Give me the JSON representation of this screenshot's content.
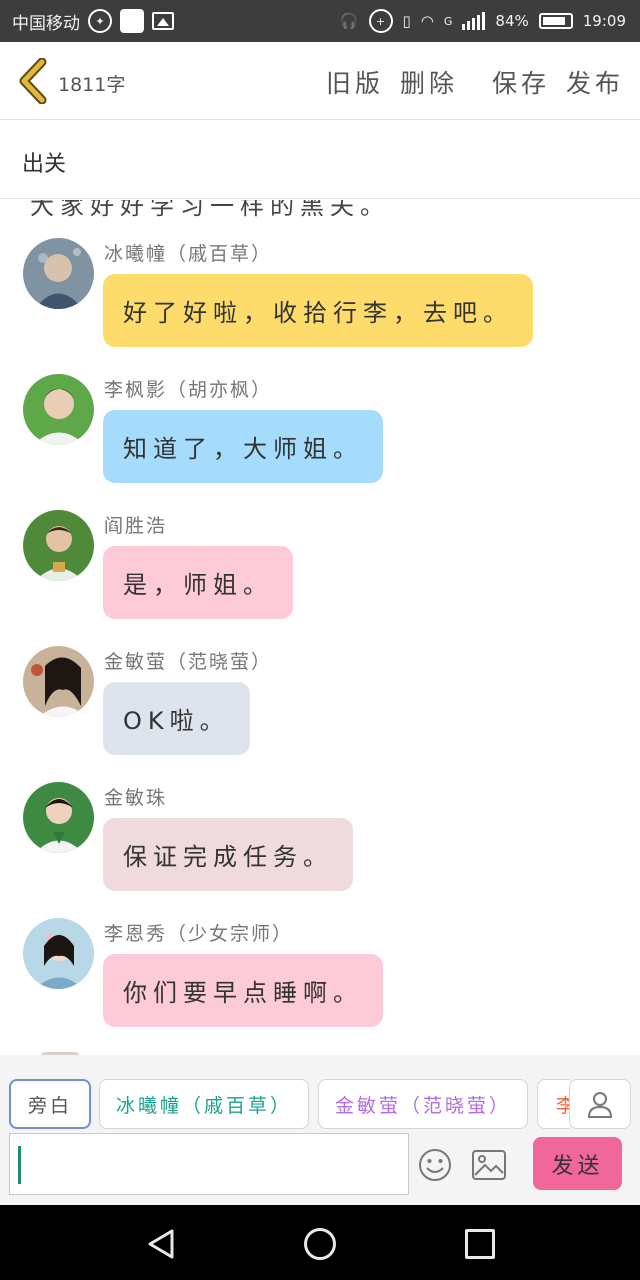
{
  "status_bar": {
    "carrier": "中国移动",
    "battery_percent": "84%",
    "battery_level": 0.84,
    "time": "19:09",
    "network": "G"
  },
  "header": {
    "word_count": "1811字",
    "buttons": [
      "旧版",
      "删除",
      "保存",
      "发布"
    ]
  },
  "title": "出关",
  "chat": {
    "cut_off_text": "大家好好学习一样的黑夫。",
    "messages": [
      {
        "sender": "冰曦幢（戚百草）",
        "text": "好了好啦，收拾行李，去吧。",
        "bubble_color": "#fddc6c"
      },
      {
        "sender": "李枫影（胡亦枫）",
        "text": "知道了，大师姐。",
        "bubble_color": "#a6dcfb"
      },
      {
        "sender": "阎胜浩",
        "text": "是，师姐。",
        "bubble_color": "#fdcad8"
      },
      {
        "sender": "金敏萤（范晓萤）",
        "text": "OK啦。",
        "bubble_color": "#dde4ee"
      },
      {
        "sender": "金敏珠",
        "text": "保证完成任务。",
        "bubble_color": "#efdadd"
      },
      {
        "sender": "李恩秀（少女宗师）",
        "text": "你们要早点睡啊。",
        "bubble_color": "#fdcad8"
      }
    ]
  },
  "composer": {
    "chips": [
      "旁白",
      "冰曦幢（戚百草）",
      "金敏萤（范晓萤）",
      "李"
    ],
    "input_value": "",
    "send_label": "发送"
  },
  "icons": {
    "back": "chevron-left-icon",
    "person": "person-icon",
    "emoji": "smiley-icon",
    "image": "image-icon"
  },
  "colors": {
    "accent": "#f2679a",
    "back_chevron": "#e5b83a",
    "cursor": "#1a8f76"
  }
}
